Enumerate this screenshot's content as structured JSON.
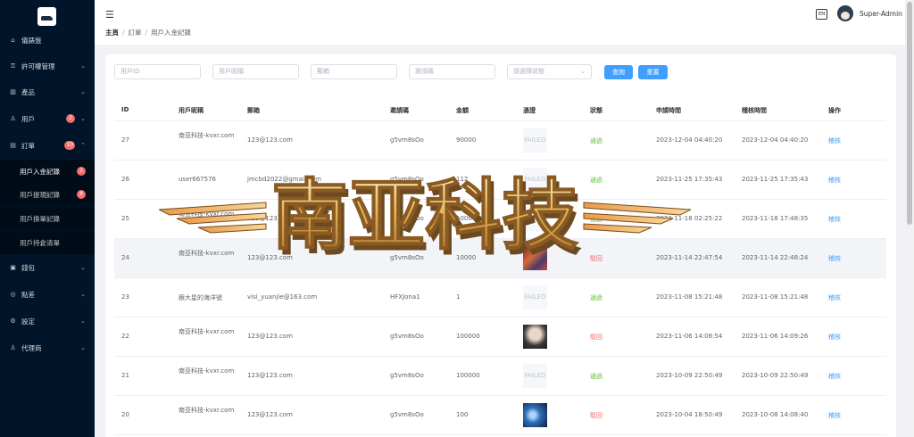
{
  "sidebar": {
    "items": [
      {
        "label": "儀錶盤",
        "icon": "home-icon"
      },
      {
        "label": "許可權管理",
        "icon": "lock-icon"
      },
      {
        "label": "產品",
        "icon": "chart-icon"
      },
      {
        "label": "用戶",
        "icon": "user-icon",
        "badge": "2"
      },
      {
        "label": "訂單",
        "icon": "order-icon",
        "badge": "10"
      },
      {
        "label": "錢包",
        "icon": "wallet-icon"
      },
      {
        "label": "點差",
        "icon": "settings-icon"
      },
      {
        "label": "設定",
        "icon": "gear-icon"
      },
      {
        "label": "代理商",
        "icon": "agent-icon"
      }
    ],
    "sub_items": [
      {
        "label": "用戶入金記錄",
        "badge": "2",
        "active": true
      },
      {
        "label": "用戶提現記錄",
        "badge": "8"
      },
      {
        "label": "用戶換單記錄"
      },
      {
        "label": "用戶持倉清單"
      }
    ]
  },
  "header": {
    "breadcrumb": [
      "主頁",
      "訂單",
      "用戶入金記錄"
    ],
    "lang": "EN",
    "username": "Super-Admin"
  },
  "filters": {
    "user_id": "用戶ID",
    "nickname": "用戶昵稱",
    "email": "郵箱",
    "invite_code": "邀請碼",
    "status": "請選擇狀態"
  },
  "buttons": {
    "search": "查詢",
    "reset": "重置"
  },
  "table": {
    "headers": [
      "ID",
      "用戶昵稱",
      "郵箱",
      "邀請碼",
      "金額",
      "憑證",
      "狀態",
      "申請時間",
      "稽核時間",
      "操作"
    ],
    "rows": [
      {
        "id": "27",
        "nickname": "南亚科技-kvxr.com",
        "email": "123@123.com",
        "invite": "g5vm8sOo",
        "amount": "90000",
        "proof": "FAILED",
        "status": "通過",
        "applied": "2023-12-04 04:40:20",
        "audited": "2023-12-04 04:40:20",
        "op": "稽核"
      },
      {
        "id": "26",
        "nickname": "user667576",
        "email": "jmcbd2022@gmail.com",
        "invite": "g5vm8sOo",
        "amount": "112",
        "proof": "FAILED",
        "status": "通過",
        "applied": "2023-11-25 17:35:43",
        "audited": "2023-11-25 17:35:43",
        "op": "稽核"
      },
      {
        "id": "25",
        "nickname": "南亚科技-kvxr.com",
        "email": "123@123.com",
        "invite": "g5vm8sOo",
        "amount": "5000",
        "proof": "FAILED",
        "status": "通過",
        "applied": "2023-11-18 02:25:22",
        "audited": "2023-11-18 17:48:35",
        "op": "稽核"
      },
      {
        "id": "24",
        "nickname": "南亚科技-kvxr.com",
        "email": "123@123.com",
        "invite": "g5vm8sOo",
        "amount": "10000",
        "proof": "image",
        "status": "駁回",
        "applied": "2023-11-14 22:47:54",
        "audited": "2023-11-14 22:48:24",
        "op": "稽核"
      },
      {
        "id": "23",
        "nickname": "跟大星的海洋號",
        "email": "visi_yuanjie@163.com",
        "invite": "HFXJona1",
        "amount": "1",
        "proof": "FAILED",
        "status": "通過",
        "applied": "2023-11-08 15:21:48",
        "audited": "2023-11-08 15:21:48",
        "op": "稽核"
      },
      {
        "id": "22",
        "nickname": "南亚科技-kvxr.com",
        "email": "123@123.com",
        "invite": "g5vm8sOo",
        "amount": "100000",
        "proof": "image",
        "status": "駁回",
        "applied": "2023-11-06 14:08:54",
        "audited": "2023-11-06 14:09:26",
        "op": "稽核"
      },
      {
        "id": "21",
        "nickname": "南亚科技-kvxr.com",
        "email": "123@123.com",
        "invite": "g5vm8sOo",
        "amount": "100000",
        "proof": "FAILED",
        "status": "通過",
        "applied": "2023-10-09 22:50:49",
        "audited": "2023-10-09 22:50:49",
        "op": "稽核"
      },
      {
        "id": "20",
        "nickname": "南亚科技-kvxr.com",
        "email": "123@123.com",
        "invite": "g5vm8sOo",
        "amount": "100",
        "proof": "image",
        "status": "駁回",
        "applied": "2023-10-04 18:50:49",
        "audited": "2023-10-08 14:08:40",
        "op": "稽核"
      }
    ]
  },
  "watermark": "南亚科技",
  "colors": {
    "sidebar_bg": "#001529",
    "primary": "#409eff",
    "success": "#67c23a",
    "danger": "#f56c6c"
  }
}
